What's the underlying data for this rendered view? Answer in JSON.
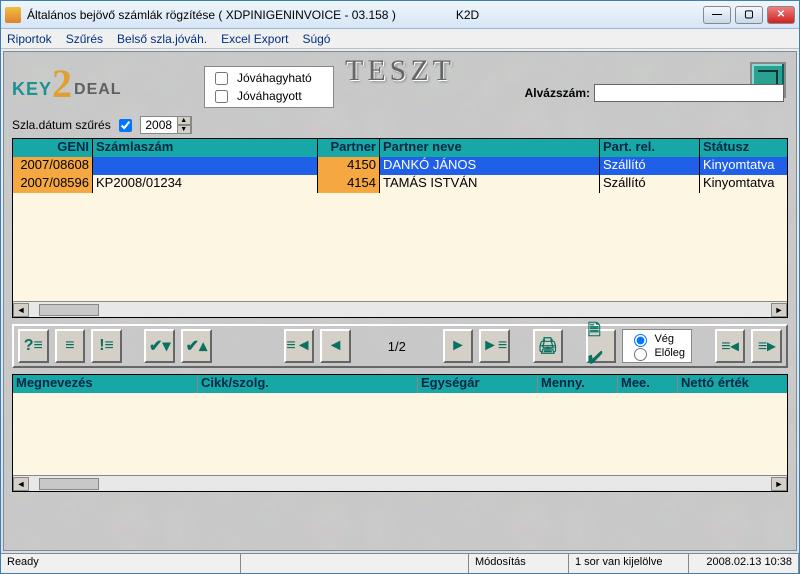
{
  "window": {
    "title": "Általános bejövő számlák rögzítése ( XDPINIGENINVOICE - 03.158 )",
    "app": "K2D"
  },
  "menus": [
    "Riportok",
    "Szűrés",
    "Belső szla.jóváh.",
    "Excel Export",
    "Súgó"
  ],
  "header": {
    "watermark": "TESZT",
    "chk_jovah": "Jóváhagyható",
    "chk_jovahagyott": "Jóváhagyott",
    "alvaz_label": "Alvázszám:",
    "alvaz_value": "",
    "filter_label": "Szla.dátum szűrés",
    "year": "2008"
  },
  "grid": {
    "col_geni": "GENI",
    "col_szamlaszam": "Számlaszám",
    "col_partner": "Partner",
    "col_partner_neve": "Partner neve",
    "col_partrel": "Part. rel.",
    "col_statusz": "Státusz",
    "rows": [
      {
        "geni": "2007/08608",
        "szam": "",
        "part": "4150",
        "pname": "DANKÓ JÁNOS",
        "prel": "Szállító",
        "stat": "Kinyomtatva"
      },
      {
        "geni": "2007/08596",
        "szam": "KP2008/01234",
        "part": "4154",
        "pname": "TAMÁS ISTVÁN",
        "prel": "Szállító",
        "stat": "Kinyomtatva"
      }
    ]
  },
  "pager": {
    "page": "1/2"
  },
  "radios": {
    "veg": "Vég",
    "eloleg": "Előleg"
  },
  "grid2": {
    "col_megnevezes": "Megnevezés",
    "col_cikk": "Cikk/szolg.",
    "col_egysegar": "Egységár",
    "col_menny": "Menny.",
    "col_mee": "Mee.",
    "col_netto": "Nettó érték"
  },
  "status": {
    "ready": "Ready",
    "modositas": "Módosítás",
    "sor": "1 sor van kijelölve",
    "dt": "2008.02.13 10:38"
  }
}
